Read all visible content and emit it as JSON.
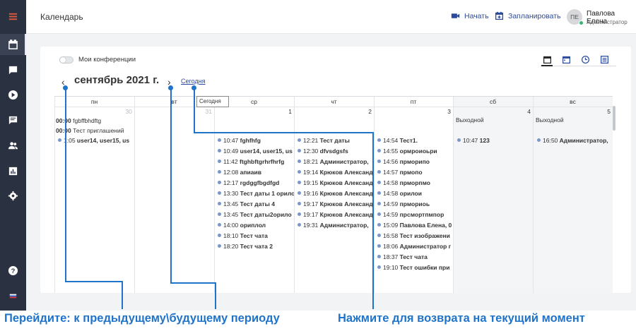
{
  "header": {
    "title": "Календарь",
    "start_label": "Начать",
    "schedule_label": "Запланировать",
    "avatar_initials": "ПЕ",
    "user_name": "Павлова Елена",
    "user_role": "Администратор"
  },
  "sidebar": {
    "items": [
      {
        "icon": "menu-icon"
      },
      {
        "icon": "calendar-icon"
      },
      {
        "icon": "chat-icon"
      },
      {
        "icon": "play-icon"
      },
      {
        "icon": "message-icon"
      },
      {
        "icon": "users-icon"
      },
      {
        "icon": "stats-icon"
      },
      {
        "icon": "settings-icon"
      },
      {
        "icon": "help-icon"
      },
      {
        "icon": "language-flag-icon"
      }
    ]
  },
  "calendar": {
    "toggle_label": "Мои конференции",
    "month_title": "сентябрь 2021 г.",
    "today_link": "Сегодня",
    "today_tooltip": "Сегодня",
    "days": [
      {
        "label": "пн",
        "num": "30",
        "muted": true
      },
      {
        "label": "вт",
        "num": "",
        "muted": false
      },
      {
        "label": "ср",
        "num": "1",
        "muted": false
      },
      {
        "label": "чт",
        "num": "2",
        "muted": false
      },
      {
        "label": "пт",
        "num": "3",
        "muted": false
      },
      {
        "label": "сб",
        "num": "4",
        "muted": false
      },
      {
        "label": "вс",
        "num": "5",
        "muted": false
      }
    ],
    "tue_num": "31",
    "monday": {
      "notes": [
        {
          "time": "00:00",
          "text": "fgbffbhdftg"
        },
        {
          "time": "00:00",
          "text": "Тест приглашений"
        }
      ],
      "events": [
        {
          "time": "1:05",
          "title": "user14, user15, us"
        }
      ]
    },
    "wednesday": [
      {
        "time": "10:47",
        "title": "fghfhfg"
      },
      {
        "time": "10:49",
        "title": "user14, user15, us"
      },
      {
        "time": "11:42",
        "title": "ftghbftgrhrfhrfg"
      },
      {
        "time": "12:08",
        "title": "апиаив"
      },
      {
        "time": "12:17",
        "title": "rgdggfbgdfgd"
      },
      {
        "time": "13:30",
        "title": "Тест даты 1 орило"
      },
      {
        "time": "13:45",
        "title": "Тест даты 4"
      },
      {
        "time": "13:45",
        "title": "Тест даты2орило"
      },
      {
        "time": "14:00",
        "title": "ориплол"
      },
      {
        "time": "18:10",
        "title": "Тест чата"
      },
      {
        "time": "18:20",
        "title": "Тест чата 2"
      }
    ],
    "thursday": [
      {
        "time": "12:21",
        "title": "Тест даты"
      },
      {
        "time": "12:30",
        "title": "dfvsdgsfs"
      },
      {
        "time": "18:21",
        "title": "Администратор,"
      },
      {
        "time": "19:14",
        "title": "Крюков Александ"
      },
      {
        "time": "19:15",
        "title": "Крюков Александ"
      },
      {
        "time": "19:16",
        "title": "Крюков Александ"
      },
      {
        "time": "19:17",
        "title": "Крюков Александ"
      },
      {
        "time": "19:17",
        "title": "Крюков Александ"
      },
      {
        "time": "19:31",
        "title": "Администратор,"
      }
    ],
    "friday": [
      {
        "time": "14:54",
        "title": "Тест1."
      },
      {
        "time": "14:55",
        "title": "ормроиоьри"
      },
      {
        "time": "14:56",
        "title": "прморипо"
      },
      {
        "time": "14:57",
        "title": "прмопо"
      },
      {
        "time": "14:58",
        "title": "прморпмо"
      },
      {
        "time": "14:58",
        "title": "орилои"
      },
      {
        "time": "14:59",
        "title": "прмориоь"
      },
      {
        "time": "14:59",
        "title": "прсмортпмпор"
      },
      {
        "time": "15:09",
        "title": "Павлова Елена, 0"
      },
      {
        "time": "16:58",
        "title": "Тест изображени"
      },
      {
        "time": "18:06",
        "title": "Администратор г"
      },
      {
        "time": "18:37",
        "title": "Тест чата"
      },
      {
        "time": "19:10",
        "title": "Тест ошибки при"
      }
    ],
    "saturday": {
      "note": "Выходной",
      "events": [
        {
          "time": "10:47",
          "title": "123"
        }
      ]
    },
    "sunday": {
      "note": "Выходной",
      "events": [
        {
          "time": "16:50",
          "title": "Администратор,"
        }
      ]
    }
  },
  "annotations": {
    "left_caption": "Перейдите: к предыдущему\\будущему периоду",
    "right_caption": "Нажмите для возврата на текущий момент"
  },
  "colors": {
    "sidebar_bg": "#2a3140",
    "accent": "#2b4a9c",
    "annotation": "#1f73c9",
    "event_dot": "#7b96c8"
  }
}
